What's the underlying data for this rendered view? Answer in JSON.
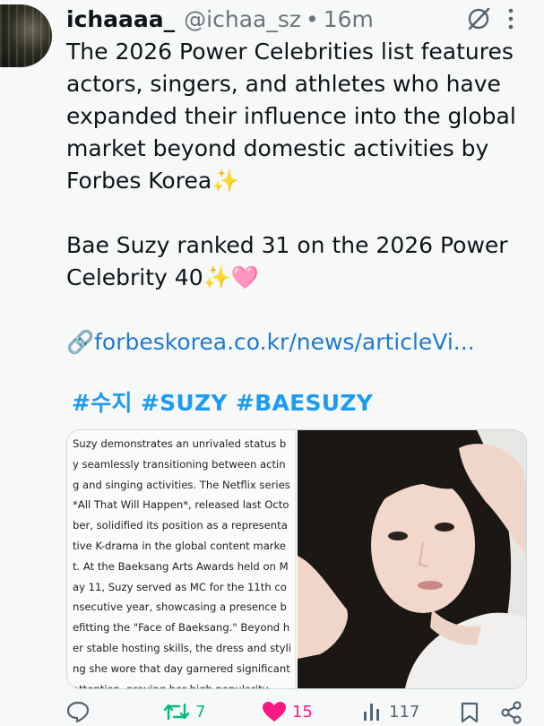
{
  "tweet": {
    "author_name": "ichaaaa_",
    "author_handle": "@ichaa_sz",
    "separator": "•",
    "timestamp": "16m",
    "lines": [
      "The 2026 Power Celebrities list features",
      "actors, singers, and athletes who have",
      "expanded their influence into the global",
      "market beyond domestic activities by",
      "Forbes Korea✨"
    ],
    "lines2": [
      "Bae Suzy ranked 31 on the 2026 Power",
      "Celebrity 40✨🩷"
    ],
    "link_text": "🔗forbeskorea.co.kr/news/articleVi...",
    "hashtags": "#수지 #SUZY #BAESUZY"
  },
  "article_text": "Suzy demonstrates an unrivaled status by seamlessly transitioning between acting and singing activities. The Netflix series *All That Will Happen*, released last October, solidified its position as a representative K-drama in the global content market. At the Baeksang Arts Awards held on May 11, Suzy served as MC for the 11th consecutive year, showcasing a presence befitting the \"Face of Baeksang.\" Beyond her stable hosting skills, the dress and styling she wore that day garnered significant attention, proving her high popularity.",
  "actions": {
    "reply_count": "",
    "retweet_count": "7",
    "like_count": "15",
    "views_count": "117"
  },
  "colors": {
    "link": "#1d7ad1",
    "hashtag": "#1d9bf0",
    "retweet": "#00ba7c",
    "like": "#f91880",
    "muted": "#536471"
  },
  "icons": [
    "avatar",
    "grok-icon",
    "more-icon",
    "reply-icon",
    "retweet-icon",
    "heart-icon",
    "views-icon",
    "bookmark-icon",
    "share-icon"
  ]
}
